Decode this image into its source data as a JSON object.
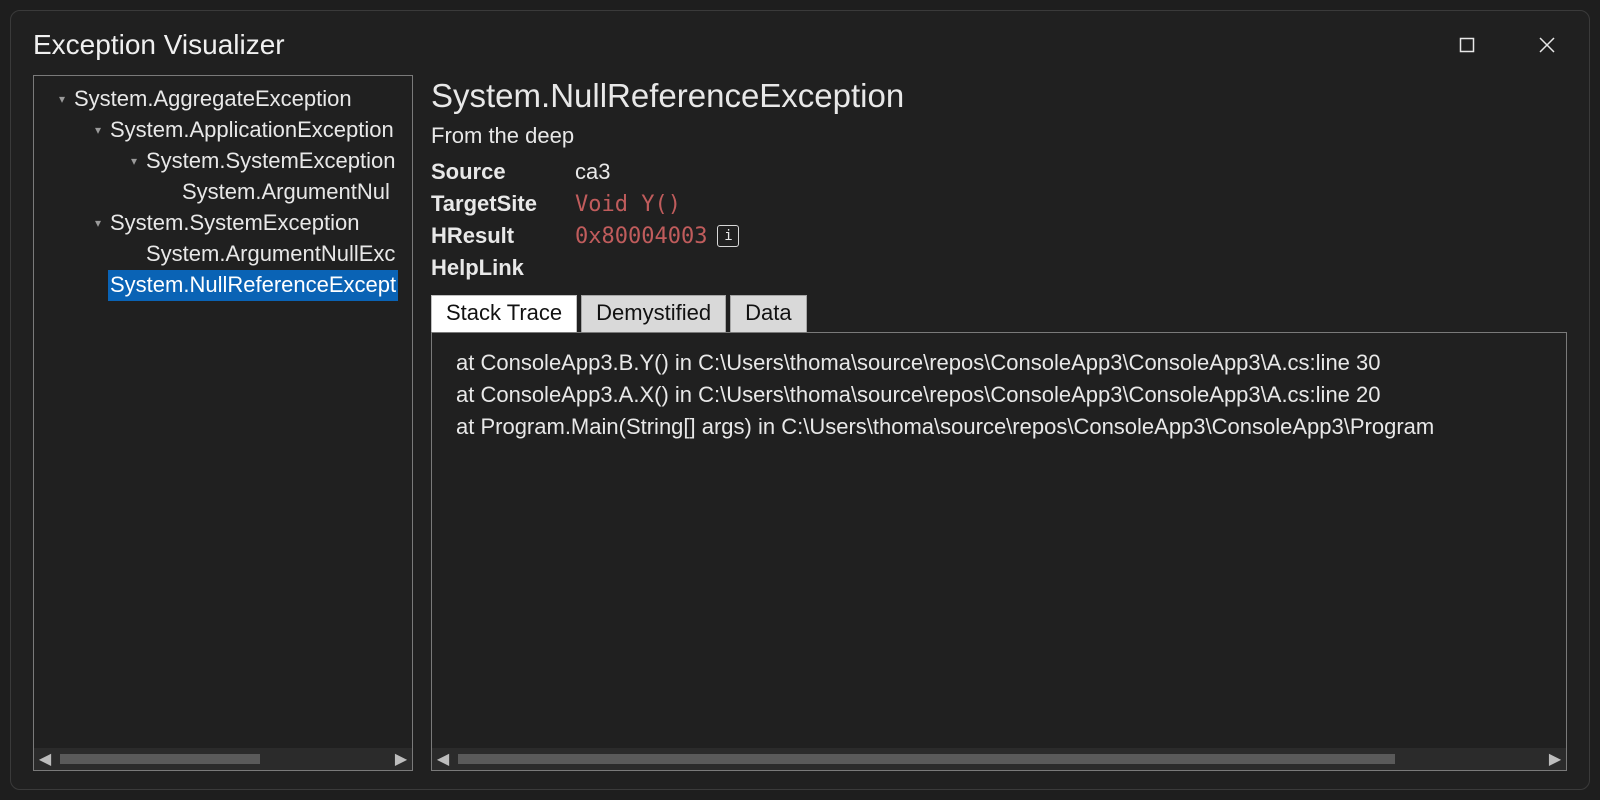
{
  "window": {
    "title": "Exception Visualizer"
  },
  "tree": {
    "items": [
      {
        "indent": 0,
        "expanded": true,
        "selected": false,
        "label": "System.AggregateException"
      },
      {
        "indent": 1,
        "expanded": true,
        "selected": false,
        "label": "System.ApplicationException"
      },
      {
        "indent": 2,
        "expanded": true,
        "selected": false,
        "label": "System.SystemException"
      },
      {
        "indent": 3,
        "expanded": null,
        "selected": false,
        "label": "System.ArgumentNul"
      },
      {
        "indent": 1,
        "expanded": true,
        "selected": false,
        "label": "System.SystemException"
      },
      {
        "indent": 2,
        "expanded": null,
        "selected": false,
        "label": "System.ArgumentNullExc"
      },
      {
        "indent": 1,
        "expanded": null,
        "selected": true,
        "label": "System.NullReferenceExcept"
      }
    ]
  },
  "detail": {
    "title": "System.NullReferenceException",
    "message": "From the deep",
    "fields": {
      "source_label": "Source",
      "source_value": "ca3",
      "targetsite_label": "TargetSite",
      "targetsite_value": "Void Y()",
      "hresult_label": "HResult",
      "hresult_value": "0x80004003",
      "helplink_label": "HelpLink",
      "helplink_value": ""
    },
    "tabs": {
      "stacktrace": "Stack Trace",
      "demystified": "Demystified",
      "data": "Data"
    },
    "stack": [
      "at ConsoleApp3.B.Y() in C:\\Users\\thoma\\source\\repos\\ConsoleApp3\\ConsoleApp3\\A.cs:line 30",
      "at ConsoleApp3.A.X() in C:\\Users\\thoma\\source\\repos\\ConsoleApp3\\ConsoleApp3\\A.cs:line 20",
      "at Program.Main(String[] args) in C:\\Users\\thoma\\source\\repos\\ConsoleApp3\\ConsoleApp3\\Program"
    ]
  }
}
